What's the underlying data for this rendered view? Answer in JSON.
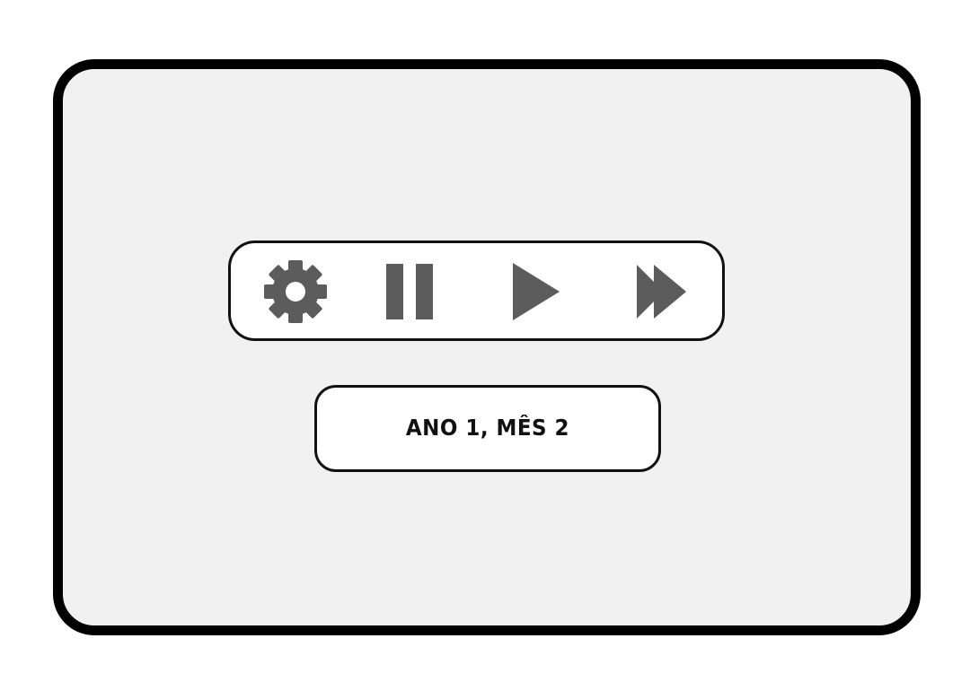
{
  "controls": {
    "icons": [
      "gear-icon",
      "pause-icon",
      "play-icon",
      "fast-forward-icon"
    ],
    "icon_color": "#5c5c5c"
  },
  "date": {
    "label": "ANO 1, MÊS 2"
  },
  "colors": {
    "panel_bg": "#f1f1f1",
    "panel_border": "#000000",
    "box_bg": "#ffffff"
  }
}
